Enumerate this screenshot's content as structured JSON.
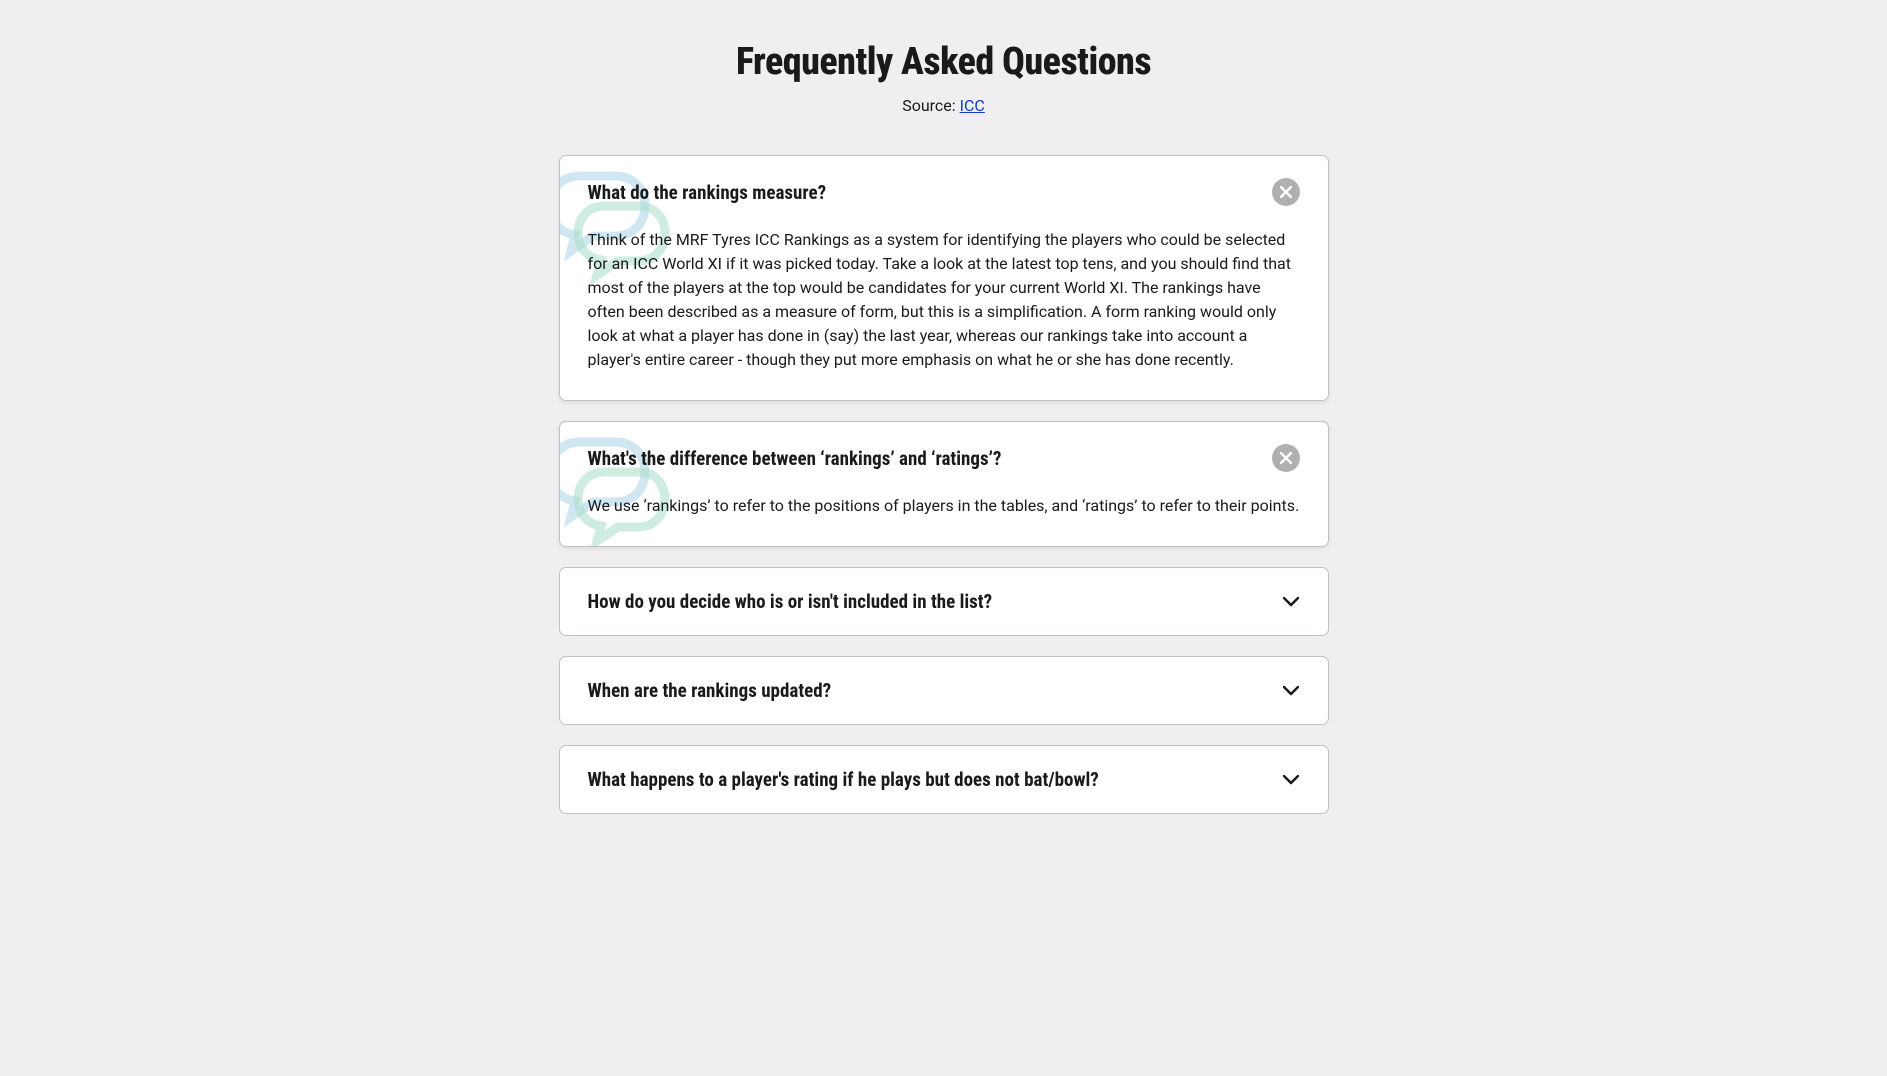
{
  "title": "Frequently Asked Questions",
  "source_label": "Source: ",
  "source_link_text": "ICC",
  "faq": [
    {
      "question": "What do the rankings measure?",
      "answer": "Think of the MRF Tyres ICC Rankings as a system for identifying the players who could be selected for an ICC World XI if it was picked today. Take a look at the latest top tens, and you should find that most of the players at the top would be candidates for your current World XI. The rankings have often been described as a measure of form, but this is a simplification. A form ranking would only look at what a player has done in (say) the last year, whereas our rankings take into account a player's entire career - though they put more emphasis on what he or she has done recently.",
      "expanded": true
    },
    {
      "question": "What's the difference between ‘rankings’ and ‘ratings’?",
      "answer": "We use ‘rankings’ to refer to the positions of players in the tables, and ‘ratings’ to refer to their points.",
      "expanded": true
    },
    {
      "question": "How do you decide who is or isn't included in the list?",
      "answer": "",
      "expanded": false
    },
    {
      "question": "When are the rankings updated?",
      "answer": "",
      "expanded": false
    },
    {
      "question": "What happens to a player's rating if he plays but does not bat/bowl?",
      "answer": "",
      "expanded": false
    }
  ]
}
